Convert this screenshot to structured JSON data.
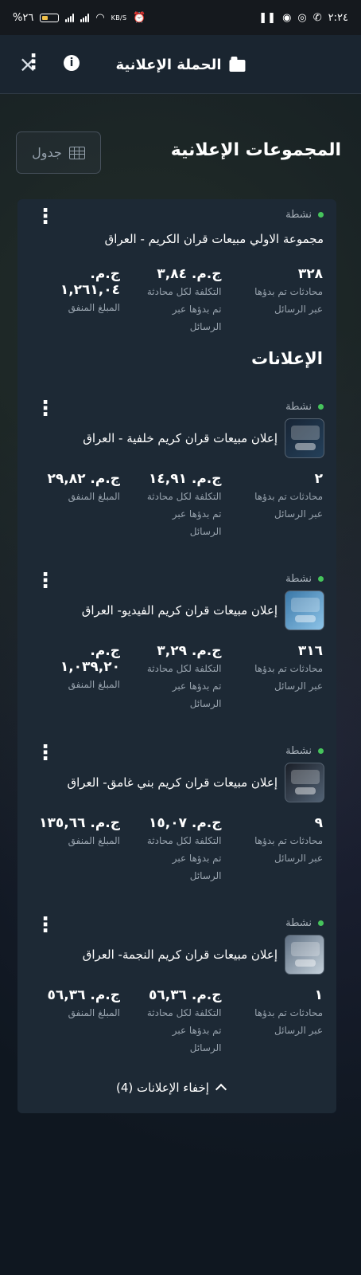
{
  "status_bar": {
    "time": "٢:٢٤",
    "battery": "%٢٦",
    "net_unit": "KB/S"
  },
  "header": {
    "title": "الحملة الإعلانية",
    "close_icon": "close-icon",
    "info_icon": "info-icon",
    "more_icon": "more-vert-icon"
  },
  "section": {
    "title": "المجموعات الإعلانية",
    "table_button_label": "جدول"
  },
  "ad_group": {
    "status": "نشطة",
    "name": "مجموعة الاولي مبيعات قران الكريم - العراق",
    "metrics": [
      {
        "value": "٣٢٨",
        "label_lines": [
          "محادثات تم بدؤها",
          "عبر الرسائل"
        ]
      },
      {
        "value": "ج.م. ٣,٨٤",
        "label_lines": [
          "التكلفة لكل محادثة",
          "تم بدؤها عبر",
          "الرسائل"
        ]
      },
      {
        "value": "ج.م. ١,٢٦١,٠٤",
        "label_lines": [
          "المبلغ المنفق"
        ]
      }
    ]
  },
  "ads_heading": "الإعلانات",
  "ads": [
    {
      "status": "نشطة",
      "name": "إعلان مبيعات قران كريم خلفية - العراق",
      "metrics": [
        {
          "value": "٢",
          "label_lines": [
            "محادثات تم بدؤها",
            "عبر الرسائل"
          ]
        },
        {
          "value": "ج.م. ١٤,٩١",
          "label_lines": [
            "التكلفة لكل محادثة",
            "تم بدؤها عبر",
            "الرسائل"
          ]
        },
        {
          "value": "ج.م. ٢٩,٨٢",
          "label_lines": [
            "المبلغ المنفق"
          ]
        }
      ]
    },
    {
      "status": "نشطة",
      "name": "إعلان مبيعات قران كريم الفيديو- العراق",
      "metrics": [
        {
          "value": "٣١٦",
          "label_lines": [
            "محادثات تم بدؤها",
            "عبر الرسائل"
          ]
        },
        {
          "value": "ج.م. ٣,٢٩",
          "label_lines": [
            "التكلفة لكل محادثة",
            "تم بدؤها عبر",
            "الرسائل"
          ]
        },
        {
          "value": "ج.م. ١,٠٣٩,٢٠",
          "label_lines": [
            "المبلغ المنفق"
          ]
        }
      ]
    },
    {
      "status": "نشطة",
      "name": "إعلان مبيعات قران كريم بني غامق- العراق",
      "metrics": [
        {
          "value": "٩",
          "label_lines": [
            "محادثات تم بدؤها",
            "عبر الرسائل"
          ]
        },
        {
          "value": "ج.م. ١٥,٠٧",
          "label_lines": [
            "التكلفة لكل محادثة",
            "تم بدؤها عبر",
            "الرسائل"
          ]
        },
        {
          "value": "ج.م. ١٣٥,٦٦",
          "label_lines": [
            "المبلغ المنفق"
          ]
        }
      ]
    },
    {
      "status": "نشطة",
      "name": "إعلان مبيعات قران كريم النجمة- العراق",
      "metrics": [
        {
          "value": "١",
          "label_lines": [
            "محادثات تم بدؤها",
            "عبر الرسائل"
          ]
        },
        {
          "value": "ج.م. ٥٦,٣٦",
          "label_lines": [
            "التكلفة لكل محادثة",
            "تم بدؤها عبر",
            "الرسائل"
          ]
        },
        {
          "value": "ج.م. ٥٦,٣٦",
          "label_lines": [
            "المبلغ المنفق"
          ]
        }
      ]
    }
  ],
  "hide_ads_label": "إخفاء الإعلانات (4)"
}
